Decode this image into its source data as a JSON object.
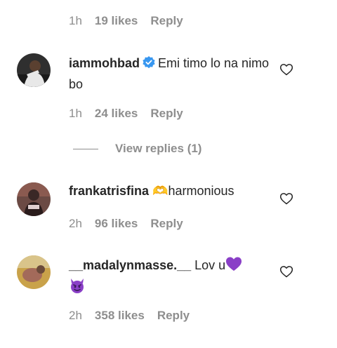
{
  "colors": {
    "text": "#262626",
    "muted": "#8e8e8e",
    "verified": "#3897f0",
    "purple": "#8a3fc7"
  },
  "top_meta": {
    "time": "1h",
    "likes": "19 likes",
    "reply": "Reply"
  },
  "comments": [
    {
      "username": "iammohbad",
      "verified": true,
      "text": "Emi timo lo na nimo bo",
      "time": "1h",
      "likes": "24 likes",
      "reply": "Reply",
      "view_replies": "View replies (1)"
    },
    {
      "username": "frankatrisfina",
      "text": "🫶harmonious",
      "time": "2h",
      "likes": "96 likes",
      "reply": "Reply"
    },
    {
      "username": "__madalynmasse.__",
      "text": "Lov u",
      "emojis": [
        "purple-heart",
        "smiling-devil"
      ],
      "time": "2h",
      "likes": "358 likes",
      "reply": "Reply"
    }
  ],
  "icons": {
    "like": "heart-outline-icon",
    "verified": "verified-badge-icon"
  }
}
